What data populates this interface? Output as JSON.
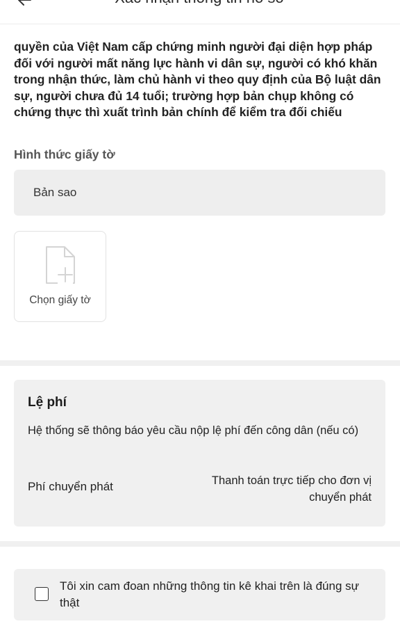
{
  "header": {
    "title": "Xác nhận thông tin hồ sơ",
    "back_icon": "arrow-left-icon"
  },
  "document": {
    "text": "quyền của Việt Nam cấp chứng minh người đại diện hợp pháp đối với người mất năng lực hành vi dân sự, người có khó khăn trong nhận thức, làm chủ hành vi theo quy định của Bộ luật dân sự, người chưa đủ 14 tuổi; trường hợp bản chụp không có chứng thực thì xuất trình bản chính để kiểm tra đối chiếu",
    "form_label": "Hình thức giấy tờ",
    "form_value": "Bản sao",
    "upload_label": "Chọn giấy tờ",
    "upload_icon": "file-plus-icon"
  },
  "fee": {
    "title": "Lệ phí",
    "description": "Hệ thống sẽ thông báo yêu cầu nộp lệ phí đến công dân (nếu có)",
    "delivery_label": "Phí chuyển phát",
    "delivery_value": "Thanh toán trực tiếp cho đơn vị chuyển phát"
  },
  "pledge": {
    "text": "Tôi xin cam đoan những thông tin kê khai trên là đúng sự thật",
    "checked": false
  },
  "colors": {
    "card_background": "#f0f0f0",
    "select_background": "#eeeeee",
    "text_primary": "#222222",
    "text_muted": "#555555"
  }
}
